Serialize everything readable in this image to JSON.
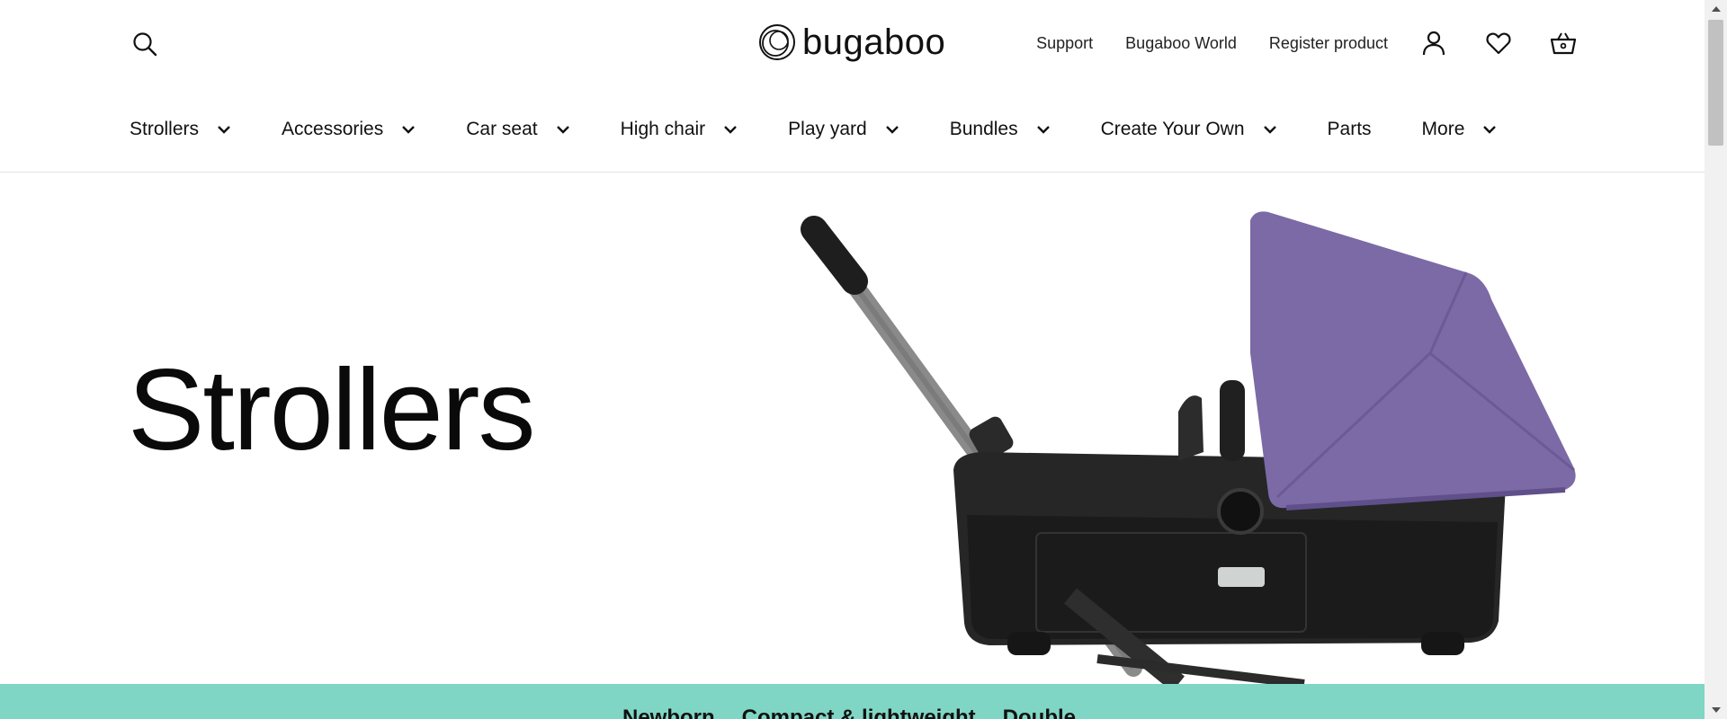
{
  "header": {
    "logo_text": "bugaboo",
    "top_links": [
      "Support",
      "Bugaboo World",
      "Register product"
    ],
    "icons": [
      "search-icon",
      "account-icon",
      "wishlist-heart-icon",
      "basket-icon"
    ]
  },
  "nav": {
    "items": [
      {
        "label": "Strollers",
        "dropdown": true
      },
      {
        "label": "Accessories",
        "dropdown": true
      },
      {
        "label": "Car seat",
        "dropdown": true
      },
      {
        "label": "High chair",
        "dropdown": true
      },
      {
        "label": "Play yard",
        "dropdown": true
      },
      {
        "label": "Bundles",
        "dropdown": true
      },
      {
        "label": "Create Your Own",
        "dropdown": true
      },
      {
        "label": "Parts",
        "dropdown": false
      },
      {
        "label": "More",
        "dropdown": true
      }
    ]
  },
  "hero": {
    "title": "Strollers"
  },
  "categories": {
    "items": [
      "Newborn",
      "Compact & lightweight",
      "Double"
    ]
  },
  "colors": {
    "accent_strip": "#7fd6c4",
    "canopy": "#7b6aa6",
    "text": "#111111"
  }
}
